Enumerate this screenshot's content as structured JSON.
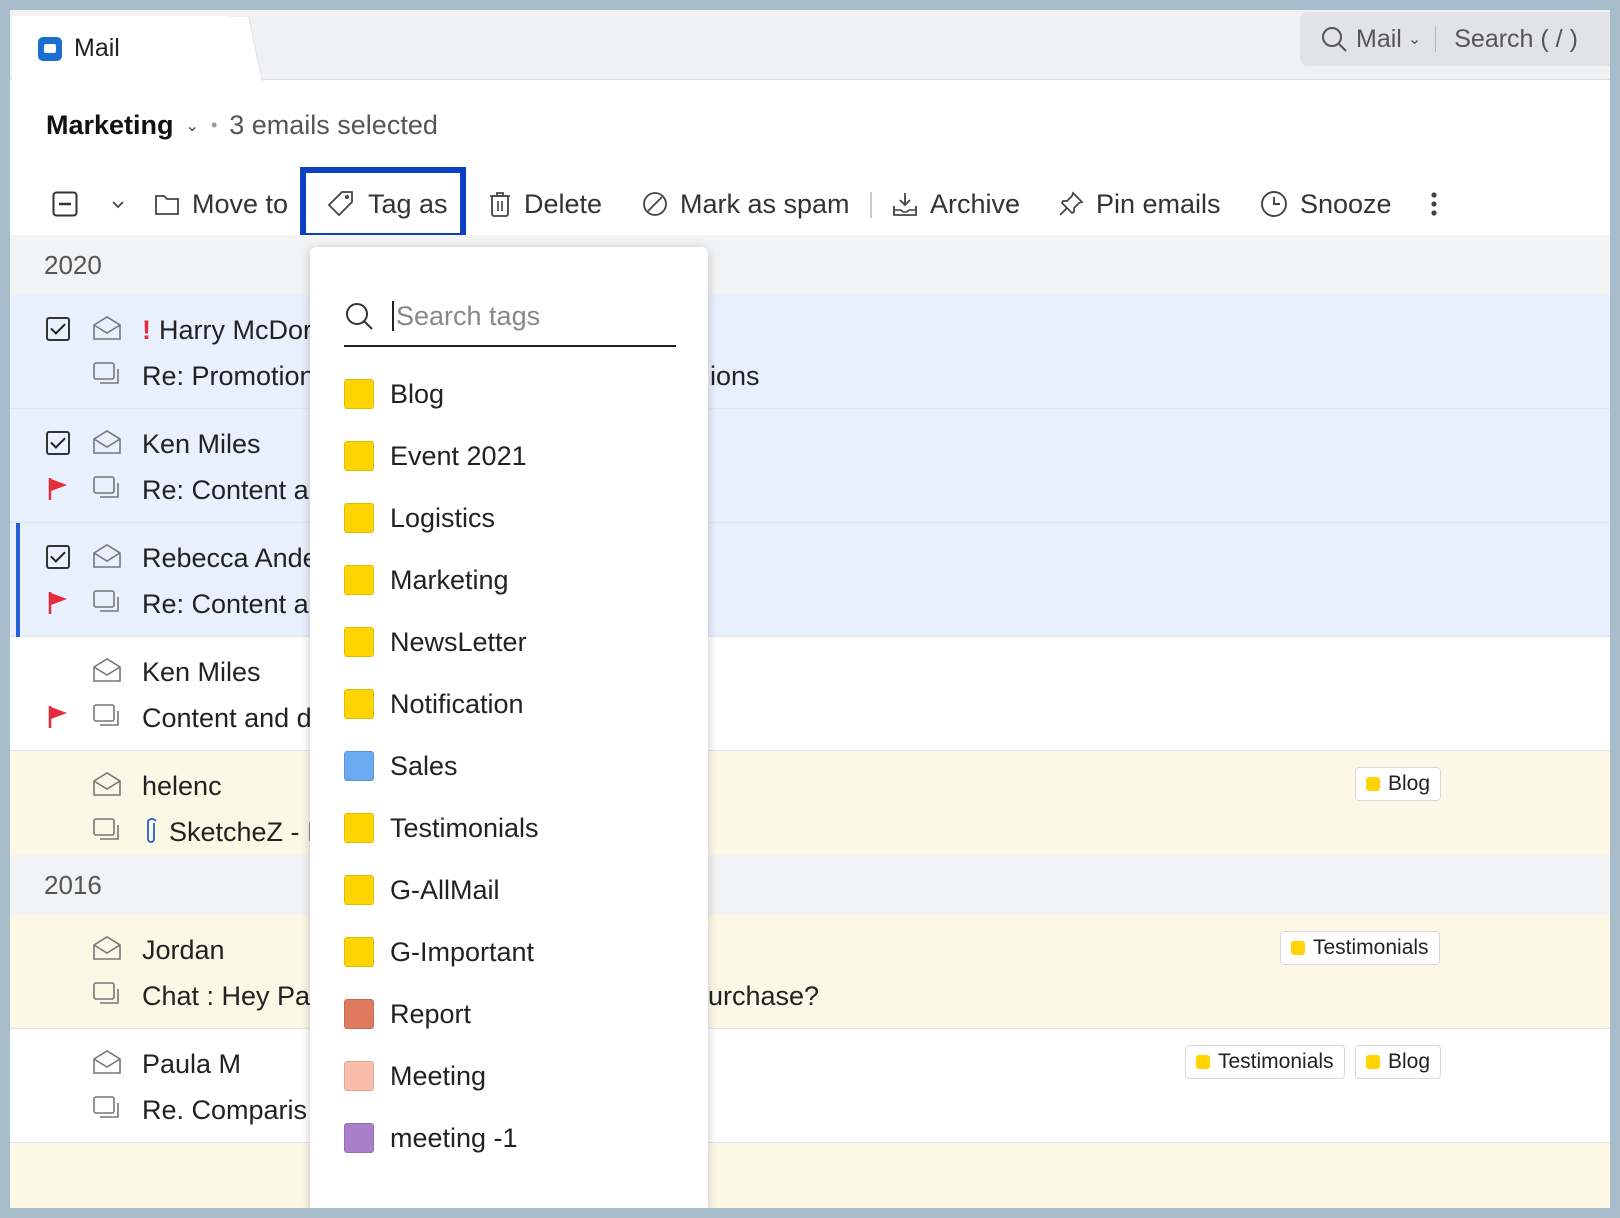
{
  "app": {
    "tab_label": "Mail"
  },
  "search": {
    "scope": "Mail",
    "placeholder": "Search ( / )"
  },
  "header": {
    "folder": "Marketing",
    "selected_text": "3 emails selected"
  },
  "toolbar": {
    "move_to": "Move to",
    "tag_as": "Tag as",
    "delete": "Delete",
    "mark_as_spam": "Mark as spam",
    "archive": "Archive",
    "pin_emails": "Pin emails",
    "snooze": "Snooze"
  },
  "groups": {
    "g2020": "2020",
    "g2016": "2016"
  },
  "emails": [
    {
      "sender": "Harry McDor",
      "subject": "Re: Promotion",
      "subject_tail": "ions",
      "priority": "!",
      "selected": true
    },
    {
      "sender": "Ken Miles",
      "subject": "Re: Content ar",
      "flagged": true,
      "selected": true
    },
    {
      "sender": "Rebecca Ande",
      "subject": "Re: Content ar",
      "flagged": true,
      "selected": true
    },
    {
      "sender": "Ken Miles",
      "subject": "Content and d",
      "flagged": true,
      "selected": false
    },
    {
      "sender": "helenc",
      "subject": "SketcheZ - I",
      "attachment": true,
      "tags": [
        "Blog"
      ]
    },
    {
      "sender": "Jordan",
      "subject": "Chat : Hey Pa",
      "subject_tail": "urchase?",
      "tags": [
        "Testimonials"
      ]
    },
    {
      "sender": "Paula M",
      "subject": "Re. Comparis",
      "tags": [
        "Testimonials",
        "Blog"
      ]
    }
  ],
  "tag_menu": {
    "search_placeholder": "Search tags",
    "tags": [
      {
        "label": "Blog",
        "color": "#ffd400"
      },
      {
        "label": "Event 2021",
        "color": "#ffd400"
      },
      {
        "label": "Logistics",
        "color": "#ffd400"
      },
      {
        "label": "Marketing",
        "color": "#ffd400"
      },
      {
        "label": "NewsLetter",
        "color": "#ffd400"
      },
      {
        "label": "Notification",
        "color": "#ffd400"
      },
      {
        "label": "Sales",
        "color": "#6aaaf0"
      },
      {
        "label": "Testimonials",
        "color": "#ffd400"
      },
      {
        "label": "G-AllMail",
        "color": "#ffd400"
      },
      {
        "label": "G-Important",
        "color": "#ffd400"
      },
      {
        "label": "Report",
        "color": "#e07a5f"
      },
      {
        "label": "Meeting",
        "color": "#f9bcaa"
      },
      {
        "label": "meeting -1",
        "color": "#a97fcb"
      }
    ]
  },
  "colors": {
    "accent": "#0b40c4",
    "flag": "#e52c3c",
    "selected_row": "#e9f0fd",
    "tagged_row": "#fdf8e6"
  }
}
